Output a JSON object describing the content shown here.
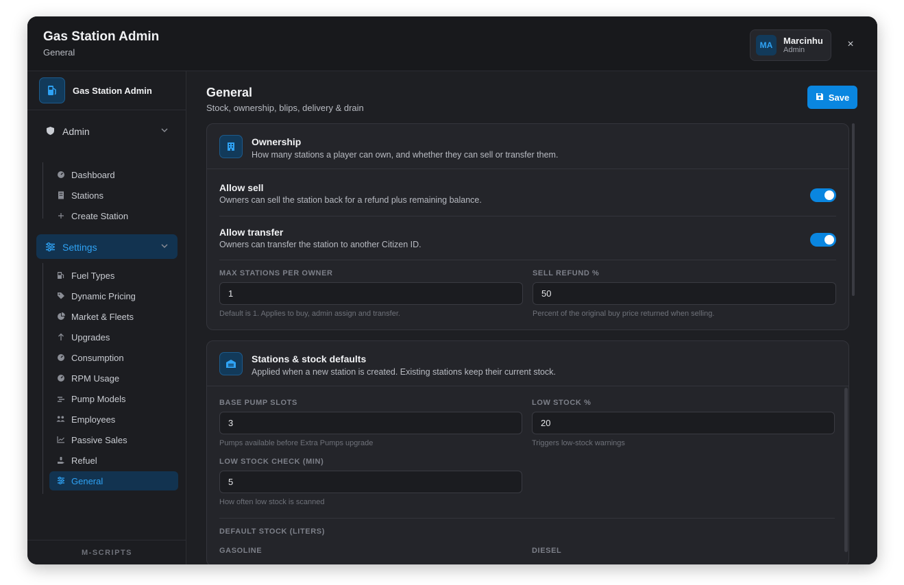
{
  "header": {
    "title": "Gas Station Admin",
    "subtitle": "General",
    "user": {
      "initials": "MA",
      "name": "Marcinhu",
      "role": "Admin"
    },
    "close_glyph": "×"
  },
  "sidebar": {
    "brand": "Gas Station Admin",
    "admin_group": {
      "label": "Admin",
      "items": [
        {
          "label": "Dashboard",
          "icon": "dashboard-icon"
        },
        {
          "label": "Stations",
          "icon": "building-icon"
        },
        {
          "label": "Create Station",
          "icon": "plus-icon"
        }
      ]
    },
    "settings_group": {
      "label": "Settings",
      "items": [
        {
          "label": "Fuel Types",
          "icon": "fuel-icon"
        },
        {
          "label": "Dynamic Pricing",
          "icon": "tag-icon"
        },
        {
          "label": "Market & Fleets",
          "icon": "pie-icon"
        },
        {
          "label": "Upgrades",
          "icon": "arrow-up-icon"
        },
        {
          "label": "Consumption",
          "icon": "gauge-icon"
        },
        {
          "label": "RPM Usage",
          "icon": "gauge-icon"
        },
        {
          "label": "Pump Models",
          "icon": "pump-icon"
        },
        {
          "label": "Employees",
          "icon": "users-icon"
        },
        {
          "label": "Passive Sales",
          "icon": "chart-line-icon"
        },
        {
          "label": "Refuel",
          "icon": "hand-icon"
        },
        {
          "label": "General",
          "icon": "sliders-icon"
        }
      ]
    },
    "footer": "M-SCRIPTS"
  },
  "main": {
    "title": "General",
    "subtitle": "Stock, ownership, blips, delivery & drain",
    "save_label": "Save",
    "ownership": {
      "title": "Ownership",
      "subtitle": "How many stations a player can own, and whether they can sell or transfer them.",
      "allow_sell": {
        "label": "Allow sell",
        "desc": "Owners can sell the station back for a refund plus remaining balance.",
        "on": true
      },
      "allow_transfer": {
        "label": "Allow transfer",
        "desc": "Owners can transfer the station to another Citizen ID.",
        "on": true
      },
      "max_stations": {
        "label": "MAX STATIONS PER OWNER",
        "value": "1",
        "hint": "Default is 1. Applies to buy, admin assign and transfer."
      },
      "sell_refund": {
        "label": "SELL REFUND %",
        "value": "50",
        "hint": "Percent of the original buy price returned when selling."
      }
    },
    "stations": {
      "title": "Stations & stock defaults",
      "subtitle": "Applied when a new station is created. Existing stations keep their current stock.",
      "base_pump_slots": {
        "label": "BASE PUMP SLOTS",
        "value": "3",
        "hint": "Pumps available before Extra Pumps upgrade"
      },
      "low_stock": {
        "label": "LOW STOCK %",
        "value": "20",
        "hint": "Triggers low-stock warnings"
      },
      "low_stock_check": {
        "label": "LOW STOCK CHECK (MIN)",
        "value": "5",
        "hint": "How often low stock is scanned"
      },
      "default_stock": {
        "label": "DEFAULT STOCK (LITERS)",
        "gasoline": "GASOLINE",
        "diesel": "DIESEL"
      }
    }
  }
}
